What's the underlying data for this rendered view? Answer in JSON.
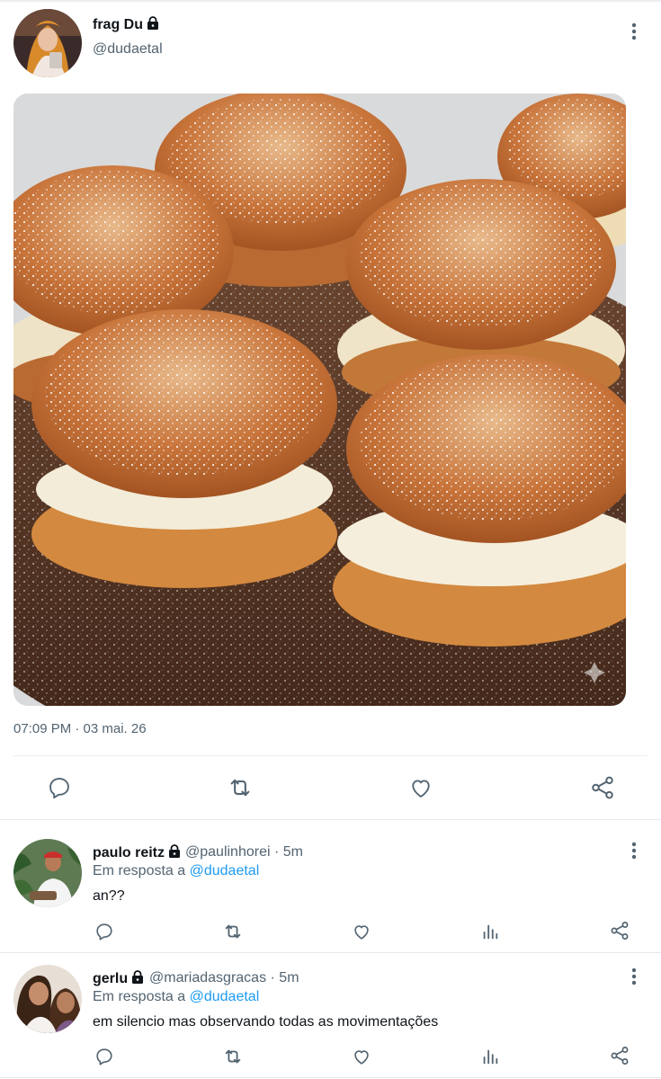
{
  "tweet": {
    "author_name": "frag Du",
    "author_handle": "@dudaetal",
    "timestamp": "07:09 PM · 03 mai. 26",
    "media_description_icon": "powdered-sugar-buns-photo"
  },
  "actions": {
    "reply_icon": "reply-icon",
    "retweet_icon": "retweet-icon",
    "like_icon": "heart-icon",
    "share_icon": "share-icon"
  },
  "replies": [
    {
      "name": "paulo reitz",
      "handle": "@paulinhorei",
      "time": "· 5m",
      "reply_prefix": "Em resposta a",
      "reply_mention": "@dudaetal",
      "text": "an??"
    },
    {
      "name": "gerlu",
      "handle": "@mariadasgracas",
      "time": "· 5m",
      "reply_prefix": "Em resposta a",
      "reply_mention": "@dudaetal",
      "text": "em silencio mas observando todas as movimentações"
    }
  ],
  "colors": {
    "accent": "#1d9bf0",
    "text": "#0f1419",
    "muted": "#536471"
  }
}
